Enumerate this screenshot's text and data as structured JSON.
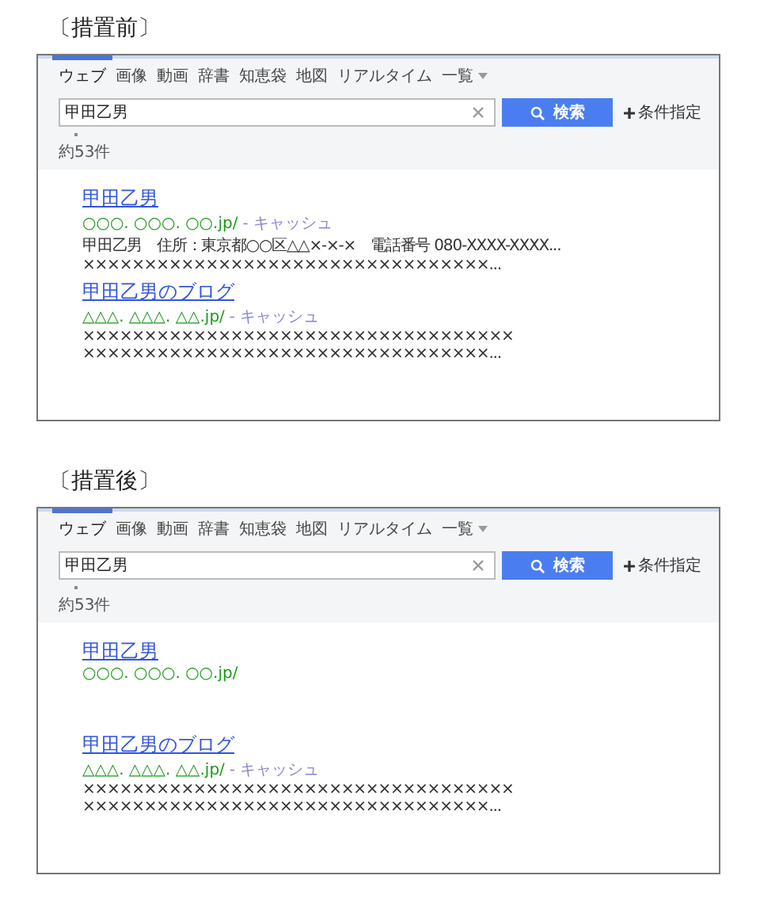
{
  "panels": [
    {
      "caption": "〔措置前〕",
      "tabs": [
        {
          "label": "ウェブ",
          "selected": true
        },
        {
          "label": "画像",
          "selected": false
        },
        {
          "label": "動画",
          "selected": false
        },
        {
          "label": "辞書",
          "selected": false
        },
        {
          "label": "知恵袋",
          "selected": false
        },
        {
          "label": "地図",
          "selected": false
        },
        {
          "label": "リアルタイム",
          "selected": false
        }
      ],
      "more_menu": "一覧",
      "search": {
        "value": "甲田乙男"
      },
      "search_button": "検索",
      "options_link": "条件指定",
      "count": "約53件",
      "results": [
        {
          "title": "甲田乙男",
          "url": "○○○. ○○○. ○○.jp/",
          "cache": "- キャッシュ",
          "snippet_lines": [
            "甲田乙男　住所：東京都○○区△△×-×-×　電話番号 080-XXXX-XXXX...",
            "×××××××××××××××××××××××××××××××××..."
          ]
        },
        {
          "title": "甲田乙男のブログ",
          "url": "△△△. △△△. △△.jp/",
          "cache": "- キャッシュ",
          "snippet_lines": [
            "×××××××××××××××××××××××××××××××××××",
            "×××××××××××××××××××××××××××××××××..."
          ]
        }
      ]
    },
    {
      "caption": "〔措置後〕",
      "tabs": [
        {
          "label": "ウェブ",
          "selected": true
        },
        {
          "label": "画像",
          "selected": false
        },
        {
          "label": "動画",
          "selected": false
        },
        {
          "label": "辞書",
          "selected": false
        },
        {
          "label": "知恵袋",
          "selected": false
        },
        {
          "label": "地図",
          "selected": false
        },
        {
          "label": "リアルタイム",
          "selected": false
        }
      ],
      "more_menu": "一覧",
      "search": {
        "value": "甲田乙男"
      },
      "search_button": "検索",
      "options_link": "条件指定",
      "count": "約53件",
      "results": [
        {
          "title": "甲田乙男",
          "url": "○○○. ○○○. ○○.jp/"
        },
        {
          "title": "甲田乙男のブログ",
          "url": "△△△. △△△. △△.jp/",
          "cache": "- キャッシュ",
          "snippet_lines": [
            "×××××××××××××××××××××××××××××××××××",
            "×××××××××××××××××××××××××××××××××..."
          ]
        }
      ]
    }
  ]
}
